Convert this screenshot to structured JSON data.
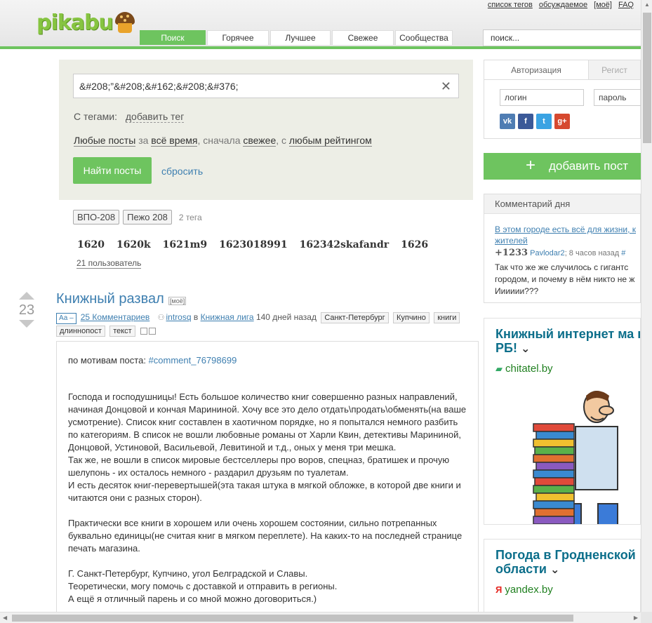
{
  "header": {
    "logo_text": "pikabu",
    "top_links": [
      "список тегов",
      "обсуждаемое",
      "[моё]",
      "FAQ"
    ],
    "nav_tabs": [
      "Поиск",
      "Горячее",
      "Лучшее",
      "Свежее",
      "Сообщества"
    ],
    "active_tab": "Поиск",
    "search_placeholder": "поиск..."
  },
  "search": {
    "query": "&#208;”&#208;&#162;&#208;&#376;",
    "tags_label": "С тегами:",
    "add_tag": "добавить тег",
    "filter": {
      "posts": "Любые посты",
      "w1": "за",
      "period": "всё время",
      "w2": ", сначала",
      "sort": "свежее",
      "w3": ", с",
      "rating": "любым рейтингом"
    },
    "find_button": "Найти посты",
    "reset_link": "сбросить"
  },
  "tag_chips": [
    "ВПО-208",
    "Пежо 208"
  ],
  "tag_count": "2 тега",
  "users": [
    "1620",
    "1620k",
    "1621m9",
    "1623018991",
    "162342skafandr",
    "1626"
  ],
  "users_count": "21 пользователь",
  "post": {
    "rating": "23",
    "title": "Книжный развал",
    "my_flag": "[моё]",
    "aa": "Аа –",
    "comments": "25 Комментариев",
    "author": "introsq",
    "in_word": "в",
    "community": "Книжная лига",
    "age": "140 дней назад",
    "tags": [
      "Санкт-Петербург",
      "Купчино",
      "книги",
      "длиннопост",
      "текст"
    ],
    "body": {
      "intro": "по мотивам поста: ",
      "intro_link": "#comment_76798699",
      "p1": "Господа и господушницы! Есть большое количество книг совершенно разных направлений, начиная Донцовой и кончая Марининой. Хочу все это дело отдать\\продать\\обменять(на ваше усмотрение). Список книг составлен в хаотичном порядке, но я попытался немного разбить по категориям. В список не вошли любовные романы от Харли Квин, детективы Марининой, Донцовой, Устиновой, Васильевой, Левитиной и т.д., оных у меня три мешка.",
      "p2": "Так же, не вошли в список мировые бестселлеры про воров, спецназ, братишек и прочую шелупонь - их осталось немного - раздарил друзьям по туалетам.",
      "p3": "И есть десяток книг-перевертышей(эта такая штука в мягкой обложке, в которой две книги и читаются они с разных сторон).",
      "p4": "Практически все книги в хорошем или очень хорошем состоянии, сильно потрепанных буквально единицы(не считая книг в мягком переплете). На каких-то на последней странице печать магазина.",
      "p5": "Г. Санкт-Петербург, Купчино, угол Белградской и Славы.",
      "p6": "Теоретически, могу помочь с доставкой и отправить в регионы.",
      "p7": "А ещё я отличный парень и со мной можно договориться.)"
    }
  },
  "sidebar": {
    "auth_tab": "Авторизация",
    "register_tab": "Регист",
    "login_placeholder": "логин",
    "password_placeholder": "пароль",
    "socials": [
      "vk",
      "f",
      "t",
      "g+"
    ],
    "add_post": "добавить пост",
    "cod": {
      "header": "Комментарий дня",
      "link": "В этом городе есть всё для жизни, к жителей",
      "plus": "+1233",
      "user": "Pavlodar2",
      "time": "; 8 часов назад",
      "hash": "#",
      "text": "Так что же же случилось с гигантс городом, и почему в нём никто не ж Ииииии???"
    },
    "ad1": {
      "title": "Книжный интернет ма в РБ!",
      "chevron": "⌄",
      "domain": "chitatel.by"
    },
    "ad2": {
      "title": "Погода в Гродненской области",
      "chevron": "⌄",
      "domain": "yandex.by"
    }
  },
  "colors": {
    "brand_green": "#6ec45f",
    "link_blue": "#3e7fb0",
    "ad_title": "#0b6e8a",
    "ad_domain": "#208020"
  }
}
